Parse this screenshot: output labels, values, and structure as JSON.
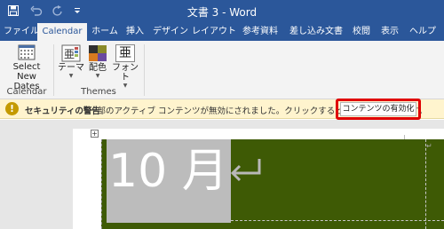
{
  "window": {
    "title": "文書 3 - Word"
  },
  "quick_access": {
    "save_icon": "save-icon",
    "undo_icon": "undo-icon",
    "redo_icon": "redo-icon",
    "customize_icon": "customize-icon"
  },
  "tabs": [
    {
      "label": "ファイル"
    },
    {
      "label": "Calendar"
    },
    {
      "label": "ホーム"
    },
    {
      "label": "挿入"
    },
    {
      "label": "デザイン"
    },
    {
      "label": "レイアウト"
    },
    {
      "label": "参考資料"
    },
    {
      "label": "差し込み文書"
    },
    {
      "label": "校閲"
    },
    {
      "label": "表示"
    },
    {
      "label": "ヘルプ"
    }
  ],
  "ribbon": {
    "calendar_group": {
      "select_dates_line1": "Select",
      "select_dates_line2": "New Dates",
      "label": "Calendar"
    },
    "themes_group": {
      "theme_label": "テーマ",
      "colors_label": "配色",
      "fonts_label": "フォント",
      "fonts_glyph": "亜",
      "label": "Themes"
    }
  },
  "security_bar": {
    "title": "セキュリティの警告",
    "message": "一部のアクティブ コンテンツが無効にされました。クリックすると詳細が表示されます。",
    "enable_button": "コンテンツの有効化"
  },
  "document": {
    "month_text": "10 月"
  },
  "colors": {
    "title_bar": "#2b579a",
    "ribbon": "#f3f3f3",
    "security_bar": "#fff4ce",
    "highlight": "#e00000",
    "calendar_green": "#3e5a05",
    "month_cell": "#bcbcbc"
  }
}
